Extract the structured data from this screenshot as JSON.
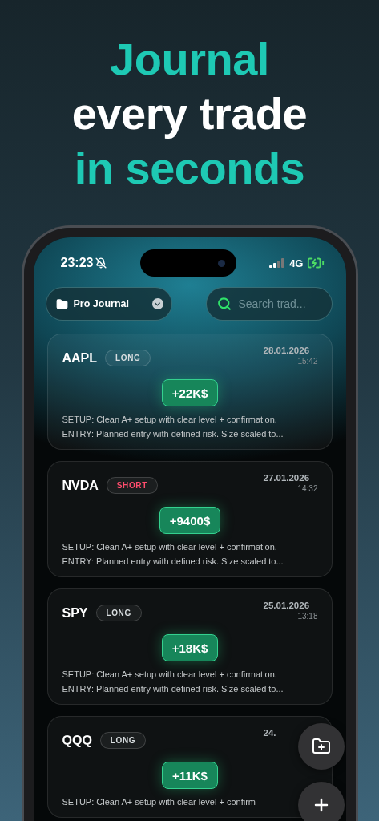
{
  "headline": [
    {
      "text": "Journal",
      "accent": true
    },
    {
      "text": "every trade",
      "accent": false
    },
    {
      "text": "in seconds",
      "accent": true
    }
  ],
  "status_bar": {
    "time": "23:23",
    "network": "4G"
  },
  "journal_picker": {
    "label": "Pro Journal"
  },
  "search": {
    "placeholder": "Search trad..."
  },
  "trades": [
    {
      "symbol": "AAPL",
      "direction": {
        "label": "LONG",
        "kind": "long"
      },
      "date": "28.01.2026",
      "time": "15:42",
      "pnl": "+22K$",
      "setup": "SETUP: Clean A+ setup with clear level + confirmation.",
      "entry": "ENTRY: Planned entry with defined risk. Size scaled to..."
    },
    {
      "symbol": "NVDA",
      "direction": {
        "label": "SHORT",
        "kind": "short"
      },
      "date": "27.01.2026",
      "time": "14:32",
      "pnl": "+9400$",
      "setup": "SETUP: Clean A+ setup with clear level + confirmation.",
      "entry": "ENTRY: Planned entry with defined risk. Size scaled to..."
    },
    {
      "symbol": "SPY",
      "direction": {
        "label": "LONG",
        "kind": "long"
      },
      "date": "25.01.2026",
      "time": "13:18",
      "pnl": "+18K$",
      "setup": "SETUP: Clean A+ setup with clear level + confirmation.",
      "entry": "ENTRY: Planned entry with defined risk. Size scaled to..."
    },
    {
      "symbol": "QQQ",
      "direction": {
        "label": "LONG",
        "kind": "long"
      },
      "date": "24.",
      "pnl": "+11K$",
      "setup": "SETUP: Clean A+ setup with clear level + confirm"
    }
  ]
}
